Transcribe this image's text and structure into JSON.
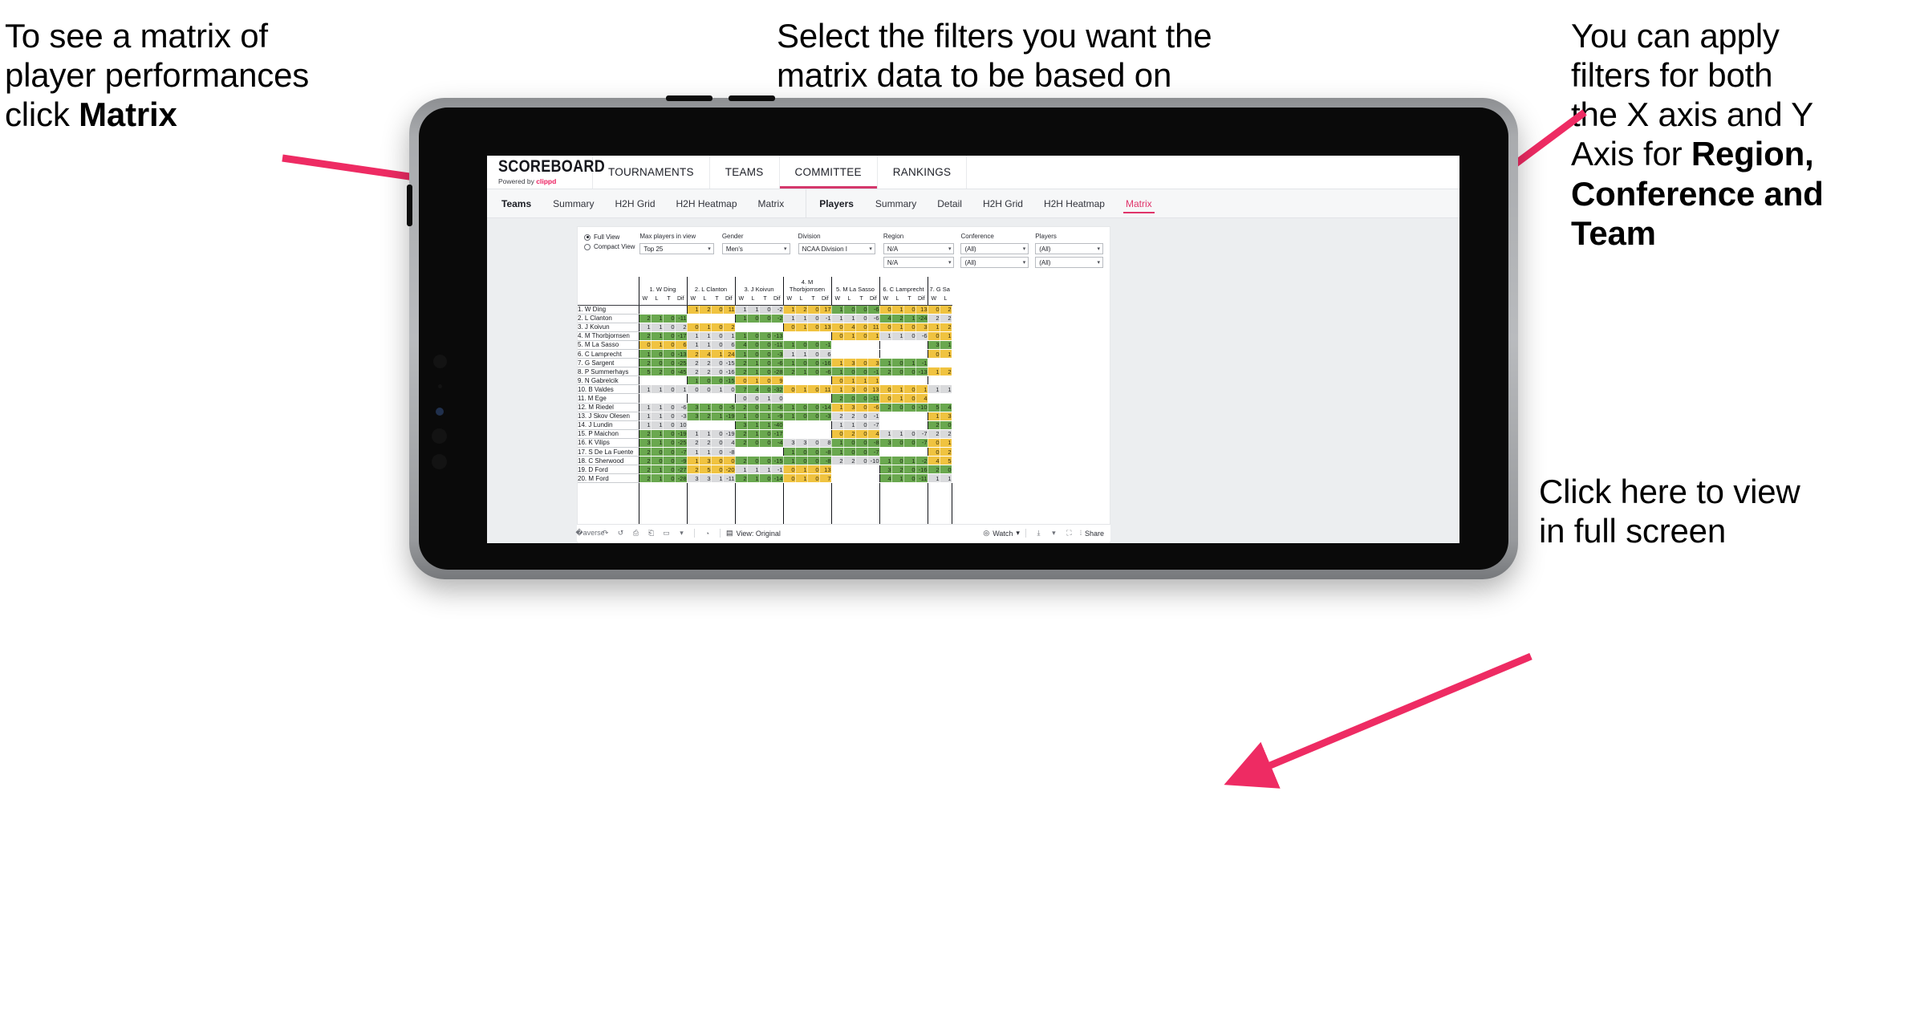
{
  "annotations": {
    "matrix_tip": {
      "text_plain": "To see a matrix of\nplayer performances\nclick ",
      "bold": "Matrix"
    },
    "filters_tip": {
      "text_plain": "Select the filters you want the\nmatrix data to be based on",
      "bold": ""
    },
    "axis_tip": {
      "text_plain": "You  can apply\nfilters for both\nthe X axis and Y\nAxis for ",
      "bold": "Region,\nConference and\nTeam"
    },
    "fullscreen_tip": {
      "text_plain": "Click here to view\nin full screen",
      "bold": ""
    }
  },
  "arrow_color": "#ee2b63",
  "navbar": {
    "brand_title": "SCOREBOARD",
    "brand_sub_prefix": "Powered by ",
    "brand_sub_mark": "clippd",
    "items": [
      {
        "label": "TOURNAMENTS",
        "active": false
      },
      {
        "label": "TEAMS",
        "active": false
      },
      {
        "label": "COMMITTEE",
        "active": true
      },
      {
        "label": "RANKINGS",
        "active": false
      }
    ]
  },
  "subbar": {
    "teams_group_label": "Teams",
    "teams_tabs": [
      "Summary",
      "H2H Grid",
      "H2H Heatmap",
      "Matrix"
    ],
    "players_group_label": "Players",
    "players_tabs": [
      "Summary",
      "Detail",
      "H2H Grid",
      "H2H Heatmap",
      "Matrix"
    ],
    "players_selected": "Matrix"
  },
  "filters": {
    "view_options": [
      {
        "label": "Full View",
        "selected": true
      },
      {
        "label": "Compact View",
        "selected": false
      }
    ],
    "fields": [
      {
        "label": "Max players in view",
        "value": "Top 25"
      },
      {
        "label": "Gender",
        "value": "Men's"
      },
      {
        "label": "Division",
        "value": "NCAA Division I"
      },
      {
        "label": "Region",
        "value": "N/A",
        "value2": "N/A"
      },
      {
        "label": "Conference",
        "value": "(All)",
        "value2": "(All)"
      },
      {
        "label": "Players",
        "value": "(All)",
        "value2": "(All)"
      }
    ]
  },
  "matrix": {
    "stat_headers": [
      "W",
      "L",
      "T",
      "Dif"
    ],
    "columns": [
      {
        "label": "1. W Ding",
        "partial": false
      },
      {
        "label": "2. L Clanton",
        "partial": false
      },
      {
        "label": "3. J Koivun",
        "partial": false
      },
      {
        "label": "4. M Thorbjornsen",
        "partial": false
      },
      {
        "label": "5. M La Sasso",
        "partial": false
      },
      {
        "label": "6. C Lamprecht",
        "partial": false
      },
      {
        "label": "7. G Sa",
        "partial": true
      }
    ],
    "rows": [
      {
        "label": "1. W Ding",
        "cells": [
          null,
          [
            "1",
            "2",
            "0",
            "11",
            "y"
          ],
          [
            "1",
            "1",
            "0",
            "-2",
            "n"
          ],
          [
            "1",
            "2",
            "0",
            "17",
            "y"
          ],
          [
            "1",
            "0",
            "0",
            "-6",
            "g"
          ],
          [
            "0",
            "1",
            "0",
            "13",
            "y"
          ],
          [
            "0",
            "2",
            "y"
          ]
        ]
      },
      {
        "label": "2. L Clanton",
        "cells": [
          [
            "2",
            "1",
            "0",
            "-11",
            "g"
          ],
          null,
          [
            "1",
            "0",
            "0",
            "-2",
            "g"
          ],
          [
            "1",
            "1",
            "0",
            "-1",
            "n"
          ],
          [
            "1",
            "1",
            "0",
            "-6",
            "n"
          ],
          [
            "4",
            "2",
            "1",
            "-24",
            "g"
          ],
          [
            "2",
            "2",
            "n"
          ]
        ]
      },
      {
        "label": "3. J Koivun",
        "cells": [
          [
            "1",
            "1",
            "0",
            "2",
            "n"
          ],
          [
            "0",
            "1",
            "0",
            "2",
            "y"
          ],
          null,
          [
            "0",
            "1",
            "0",
            "13",
            "y"
          ],
          [
            "0",
            "4",
            "0",
            "11",
            "y"
          ],
          [
            "0",
            "1",
            "0",
            "3",
            "y"
          ],
          [
            "1",
            "2",
            "y"
          ]
        ]
      },
      {
        "label": "4. M Thorbjornsen",
        "cells": [
          [
            "2",
            "1",
            "0",
            "-17",
            "g"
          ],
          [
            "1",
            "1",
            "0",
            "1",
            "n"
          ],
          [
            "1",
            "0",
            "0",
            "-13",
            "g"
          ],
          null,
          [
            "0",
            "1",
            "0",
            "1",
            "y"
          ],
          [
            "1",
            "1",
            "0",
            "-6",
            "n"
          ],
          [
            "0",
            "1",
            "y"
          ]
        ]
      },
      {
        "label": "5. M La Sasso",
        "cells": [
          [
            "0",
            "1",
            "0",
            "6",
            "y"
          ],
          [
            "1",
            "1",
            "0",
            "6",
            "n"
          ],
          [
            "4",
            "0",
            "0",
            "-11",
            "g"
          ],
          [
            "1",
            "0",
            "0",
            "-1",
            "g"
          ],
          null,
          null,
          [
            "3",
            "1",
            "g"
          ]
        ]
      },
      {
        "label": "6. C Lamprecht",
        "cells": [
          [
            "1",
            "0",
            "0",
            "-13",
            "g"
          ],
          [
            "2",
            "4",
            "1",
            "24",
            "y"
          ],
          [
            "1",
            "0",
            "0",
            "-3",
            "g"
          ],
          [
            "1",
            "1",
            "0",
            "6",
            "n"
          ],
          null,
          null,
          [
            "0",
            "1",
            "y"
          ]
        ]
      },
      {
        "label": "7. G Sargent",
        "cells": [
          [
            "2",
            "0",
            "0",
            "-25",
            "g"
          ],
          [
            "2",
            "2",
            "0",
            "-15",
            "n"
          ],
          [
            "2",
            "1",
            "0",
            "-6",
            "g"
          ],
          [
            "1",
            "0",
            "0",
            "-16",
            "g"
          ],
          [
            "1",
            "3",
            "0",
            "3",
            "y"
          ],
          [
            "1",
            "0",
            "1",
            "-1",
            "g"
          ],
          null
        ]
      },
      {
        "label": "8. P Summerhays",
        "cells": [
          [
            "5",
            "2",
            "0",
            "-45",
            "g"
          ],
          [
            "2",
            "2",
            "0",
            "-16",
            "n"
          ],
          [
            "2",
            "1",
            "0",
            "-28",
            "g"
          ],
          [
            "2",
            "1",
            "0",
            "-6",
            "g"
          ],
          [
            "1",
            "0",
            "0",
            "-1",
            "g"
          ],
          [
            "2",
            "0",
            "0",
            "-13",
            "g"
          ],
          [
            "1",
            "2",
            "y"
          ]
        ]
      },
      {
        "label": "9. N Gabrelcik",
        "cells": [
          null,
          [
            "1",
            "0",
            "0",
            "-15",
            "g"
          ],
          [
            "0",
            "1",
            "0",
            "9",
            "y"
          ],
          null,
          [
            "0",
            "1",
            "1",
            "1",
            "y"
          ],
          null,
          null
        ]
      },
      {
        "label": "10. B Valdes",
        "cells": [
          [
            "1",
            "1",
            "0",
            "1",
            "n"
          ],
          [
            "0",
            "0",
            "1",
            "0",
            "n"
          ],
          [
            "7",
            "4",
            "0",
            "-32",
            "g"
          ],
          [
            "0",
            "1",
            "0",
            "11",
            "y"
          ],
          [
            "1",
            "3",
            "0",
            "13",
            "y"
          ],
          [
            "0",
            "1",
            "0",
            "1",
            "y"
          ],
          [
            "1",
            "1",
            "n"
          ]
        ]
      },
      {
        "label": "11. M Ege",
        "cells": [
          null,
          null,
          [
            "0",
            "0",
            "1",
            "0",
            "n"
          ],
          null,
          [
            "2",
            "0",
            "0",
            "-11",
            "g"
          ],
          [
            "0",
            "1",
            "0",
            "4",
            "y"
          ],
          null
        ]
      },
      {
        "label": "12. M Riedel",
        "cells": [
          [
            "1",
            "1",
            "0",
            "-6",
            "n"
          ],
          [
            "3",
            "1",
            "0",
            "-5",
            "g"
          ],
          [
            "2",
            "0",
            "1",
            "-6",
            "g"
          ],
          [
            "1",
            "0",
            "0",
            "-14",
            "g"
          ],
          [
            "1",
            "3",
            "0",
            "-6",
            "y"
          ],
          [
            "2",
            "0",
            "0",
            "-10",
            "g"
          ],
          [
            "5",
            "4",
            "g"
          ]
        ]
      },
      {
        "label": "13. J Skov Olesen",
        "cells": [
          [
            "1",
            "1",
            "0",
            "-3",
            "n"
          ],
          [
            "3",
            "2",
            "1",
            "-19",
            "g"
          ],
          [
            "1",
            "0",
            "1",
            "-9",
            "g"
          ],
          [
            "1",
            "0",
            "0",
            "-3",
            "g"
          ],
          [
            "2",
            "2",
            "0",
            "-1",
            "n"
          ],
          null,
          [
            "1",
            "3",
            "y"
          ]
        ]
      },
      {
        "label": "14. J Lundin",
        "cells": [
          [
            "1",
            "1",
            "0",
            "10",
            "n"
          ],
          null,
          [
            "3",
            "1",
            "1",
            "-40",
            "g"
          ],
          null,
          [
            "1",
            "1",
            "0",
            "-7",
            "n"
          ],
          null,
          [
            "2",
            "0",
            "g"
          ]
        ]
      },
      {
        "label": "15. P Maichon",
        "cells": [
          [
            "2",
            "1",
            "0",
            "-19",
            "g"
          ],
          [
            "1",
            "1",
            "0",
            "-19",
            "n"
          ],
          [
            "2",
            "1",
            "0",
            "-17",
            "g"
          ],
          null,
          [
            "0",
            "2",
            "0",
            "4",
            "y"
          ],
          [
            "1",
            "1",
            "0",
            "-7",
            "n"
          ],
          [
            "2",
            "2",
            "n"
          ]
        ]
      },
      {
        "label": "16. K Vilips",
        "cells": [
          [
            "3",
            "1",
            "0",
            "-25",
            "g"
          ],
          [
            "2",
            "2",
            "0",
            "4",
            "n"
          ],
          [
            "2",
            "0",
            "0",
            "-4",
            "g"
          ],
          [
            "3",
            "3",
            "0",
            "8",
            "n"
          ],
          [
            "1",
            "0",
            "0",
            "-8",
            "g"
          ],
          [
            "3",
            "0",
            "0",
            "-7",
            "g"
          ],
          [
            "0",
            "1",
            "y"
          ]
        ]
      },
      {
        "label": "17. S De La Fuente",
        "cells": [
          [
            "2",
            "0",
            "0",
            "-7",
            "g"
          ],
          [
            "1",
            "1",
            "0",
            "-8",
            "n"
          ],
          null,
          [
            "1",
            "0",
            "0",
            "-8",
            "g"
          ],
          [
            "1",
            "0",
            "0",
            "-7",
            "g"
          ],
          null,
          [
            "0",
            "2",
            "y"
          ]
        ]
      },
      {
        "label": "18. C Sherwood",
        "cells": [
          [
            "2",
            "0",
            "0",
            "-9",
            "g"
          ],
          [
            "1",
            "3",
            "0",
            "0",
            "y"
          ],
          [
            "2",
            "0",
            "0",
            "-15",
            "g"
          ],
          [
            "1",
            "0",
            "0",
            "-8",
            "g"
          ],
          [
            "2",
            "2",
            "0",
            "-10",
            "n"
          ],
          [
            "1",
            "0",
            "1",
            "-2",
            "g"
          ],
          [
            "4",
            "5",
            "y"
          ]
        ]
      },
      {
        "label": "19. D Ford",
        "cells": [
          [
            "2",
            "1",
            "0",
            "-27",
            "g"
          ],
          [
            "2",
            "5",
            "0",
            "-20",
            "y"
          ],
          [
            "1",
            "1",
            "1",
            "-1",
            "n"
          ],
          [
            "0",
            "1",
            "0",
            "13",
            "y"
          ],
          null,
          [
            "3",
            "2",
            "0",
            "-16",
            "g"
          ],
          [
            "2",
            "0",
            "g"
          ]
        ]
      },
      {
        "label": "20. M Ford",
        "cells": [
          [
            "2",
            "1",
            "0",
            "-28",
            "g"
          ],
          [
            "3",
            "3",
            "1",
            "-11",
            "n"
          ],
          [
            "2",
            "1",
            "0",
            "-14",
            "g"
          ],
          [
            "0",
            "1",
            "0",
            "7",
            "y"
          ],
          null,
          [
            "4",
            "1",
            "0",
            "-11",
            "g"
          ],
          [
            "1",
            "1",
            "n"
          ]
        ]
      }
    ]
  },
  "toolbar": {
    "icons": [
      "undo-icon",
      "redo-icon",
      "revert-icon",
      "pause-icon",
      "refresh-icon",
      "bookmark-icon",
      "caret-down-icon"
    ],
    "view_icon": "view-icon",
    "view_label": "View: Original",
    "watch_label": "Watch",
    "watch_icon": "eye-icon",
    "download_icon": "download-icon",
    "fullscreen_icon": "fullscreen-icon",
    "share_icon": "share-icon",
    "share_label": "Share"
  },
  "colors": {
    "accent_pink": "#e0346a",
    "brand_pink": "#ec1c5e",
    "green": "#6aa84f",
    "yellow": "#f0c340",
    "neutral": "#d9dadc",
    "arrow": "#ee2b63"
  }
}
